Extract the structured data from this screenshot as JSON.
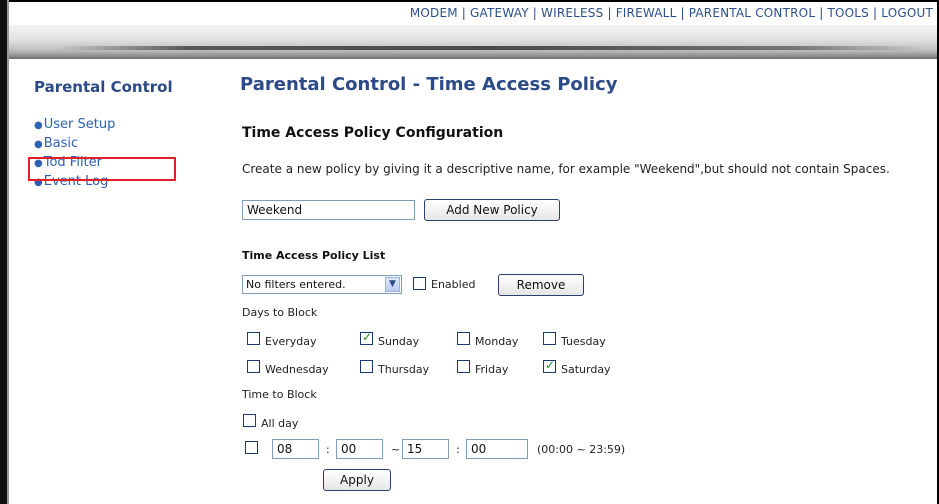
{
  "top_nav": {
    "items": [
      "MODEM",
      "GATEWAY",
      "WIRELESS",
      "FIREWALL",
      "PARENTAL CONTROL",
      "TOOLS",
      "LOGOUT"
    ],
    "separator": "|"
  },
  "sidebar": {
    "title": "Parental Control",
    "items": [
      {
        "label": "User Setup"
      },
      {
        "label": "Basic"
      },
      {
        "label": "Tod Filter"
      },
      {
        "label": "Event Log"
      }
    ]
  },
  "main": {
    "title": "Parental Control - Time Access Policy",
    "config": {
      "heading": "Time Access Policy Configuration",
      "description": "Create a new policy by giving it a descriptive name, for example \"Weekend\",but should not contain Spaces.",
      "policy_name_value": "Weekend",
      "add_button": "Add New Policy"
    },
    "policy_list": {
      "heading": "Time Access Policy List",
      "select_value": "No filters entered.",
      "enabled_label": "Enabled",
      "enabled_checked": false,
      "remove_button": "Remove"
    },
    "days": {
      "heading": "Days to Block",
      "everyday": {
        "label": "Everyday",
        "checked": false
      },
      "sunday": {
        "label": "Sunday",
        "checked": true
      },
      "monday": {
        "label": "Monday",
        "checked": false
      },
      "tuesday": {
        "label": "Tuesday",
        "checked": false
      },
      "wednesday": {
        "label": "Wednesday",
        "checked": false
      },
      "thursday": {
        "label": "Thursday",
        "checked": false
      },
      "friday": {
        "label": "Friday",
        "checked": false
      },
      "saturday": {
        "label": "Saturday",
        "checked": true
      }
    },
    "time": {
      "heading": "Time to Block",
      "all_day_label": "All day",
      "all_day_checked": false,
      "range_checked": false,
      "start_hour": "08",
      "start_min": "00",
      "end_hour": "15",
      "end_min": "00",
      "colon": ":",
      "tilde": "~",
      "range_hint": "(00:00 ~ 23:59)",
      "apply_button": "Apply"
    }
  },
  "colors": {
    "title_blue": "#2b4a86",
    "link_blue": "#2d62b3",
    "highlight_red": "#e0202a",
    "check_green": "#1d8a1d"
  }
}
